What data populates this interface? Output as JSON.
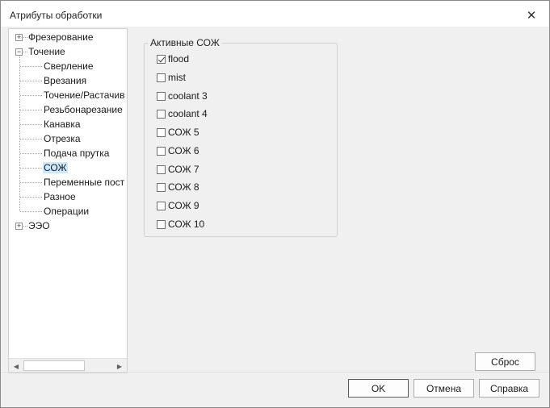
{
  "window": {
    "title": "Атрибуты обработки",
    "close_glyph": "✕"
  },
  "tree": {
    "items": [
      {
        "label": "Фрезерование",
        "level": 0,
        "expander": "+"
      },
      {
        "label": "Точение",
        "level": 0,
        "expander": "−"
      },
      {
        "label": "Сверление",
        "level": 1
      },
      {
        "label": "Врезания",
        "level": 1
      },
      {
        "label": "Точение/Растачив",
        "level": 1
      },
      {
        "label": "Резьбонарезание",
        "level": 1
      },
      {
        "label": "Канавка",
        "level": 1
      },
      {
        "label": "Отрезка",
        "level": 1
      },
      {
        "label": "Подача прутка",
        "level": 1
      },
      {
        "label": "СОЖ",
        "level": 1,
        "selected": true
      },
      {
        "label": "Переменные пост",
        "level": 1
      },
      {
        "label": "Разное",
        "level": 1
      },
      {
        "label": "Операции",
        "level": 1
      },
      {
        "label": "ЭЭО",
        "level": 0,
        "expander": "+"
      }
    ],
    "scroll_left": "◀",
    "scroll_right": "▶"
  },
  "coolants": {
    "group_title": "Активные СОЖ",
    "items": [
      {
        "label": "flood",
        "checked": true
      },
      {
        "label": "mist",
        "checked": false
      },
      {
        "label": "coolant 3",
        "checked": false
      },
      {
        "label": "coolant 4",
        "checked": false
      },
      {
        "label": "СОЖ 5",
        "checked": false
      },
      {
        "label": "СОЖ 6",
        "checked": false
      },
      {
        "label": "СОЖ 7",
        "checked": false
      },
      {
        "label": "СОЖ 8",
        "checked": false
      },
      {
        "label": "СОЖ 9",
        "checked": false
      },
      {
        "label": "СОЖ 10",
        "checked": false
      }
    ]
  },
  "buttons": {
    "reset": "Сброс",
    "ok": "OK",
    "cancel": "Отмена",
    "help": "Справка"
  }
}
